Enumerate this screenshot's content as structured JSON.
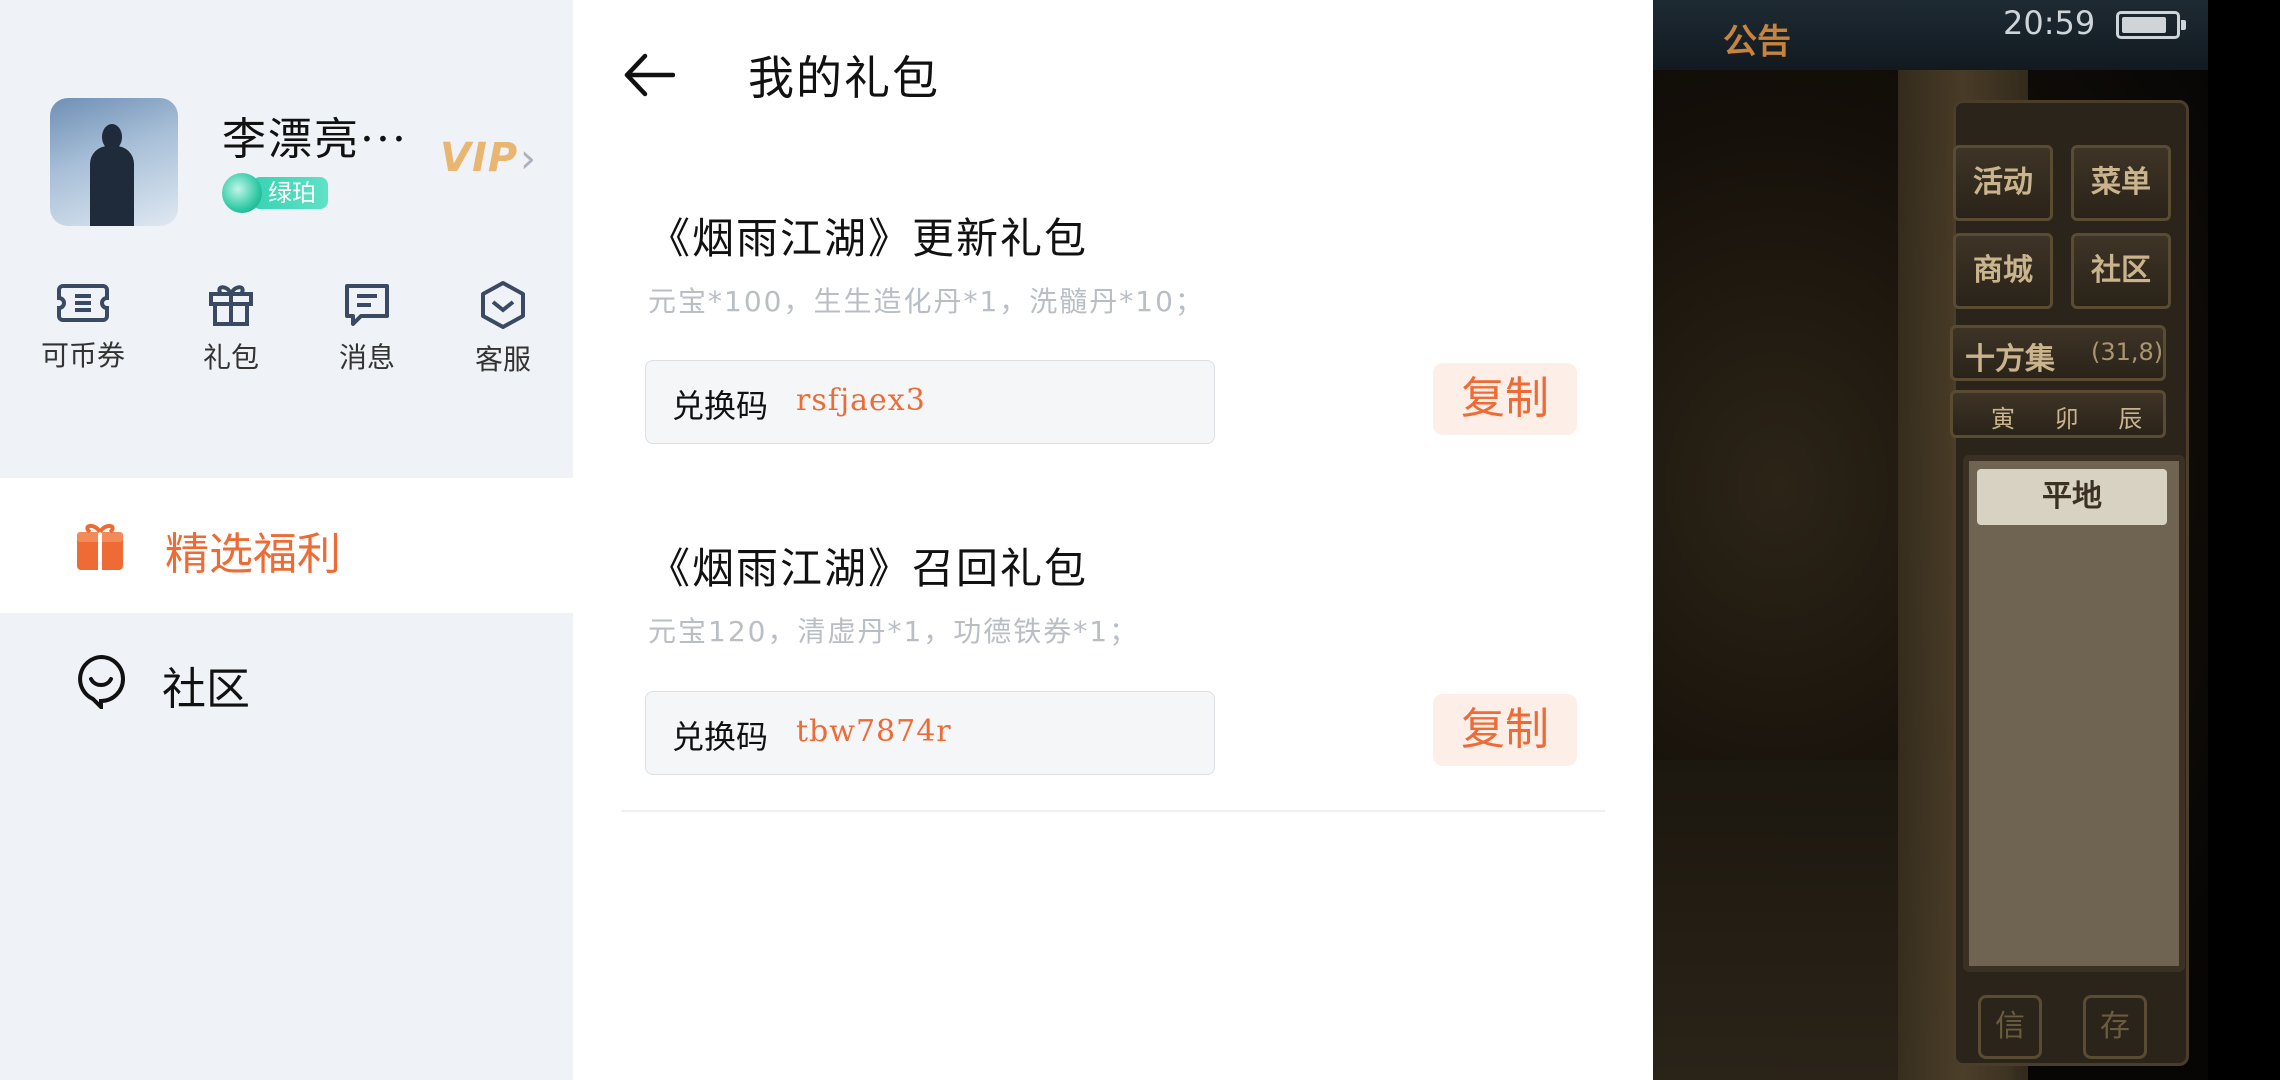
{
  "profile": {
    "username": "李漂亮···",
    "level": "绿珀",
    "vip": "VIP"
  },
  "quick_menu": [
    {
      "label": "可币券",
      "icon": "coupon-icon"
    },
    {
      "label": "礼包",
      "icon": "gift-icon"
    },
    {
      "label": "消息",
      "icon": "message-icon"
    },
    {
      "label": "客服",
      "icon": "customer-service-icon"
    }
  ],
  "nav": {
    "selected": {
      "label": "精选福利",
      "icon": "gift-box-icon"
    },
    "community": {
      "label": "社区",
      "icon": "community-icon"
    }
  },
  "main": {
    "title": "我的礼包",
    "gifts": [
      {
        "title": "《烟雨江湖》更新礼包",
        "desc": "元宝*100，生生造化丹*1，洗髓丹*10；",
        "code_label": "兑换码",
        "code": "rsfjaex3",
        "copy_label": "复制"
      },
      {
        "title": "《烟雨江湖》召回礼包",
        "desc": "元宝120，清虚丹*1，功德铁券*1；",
        "code_label": "兑换码",
        "code": "tbw7874r",
        "copy_label": "复制"
      }
    ]
  },
  "game": {
    "notice": "公告",
    "time": "20:59",
    "buttons": [
      "活动",
      "菜单",
      "商城",
      "社区"
    ],
    "location_name": "十方集",
    "coords": "(31,8)",
    "time_dial": "寅 卯 辰",
    "terrain": "平地",
    "bottom_buttons": [
      "信",
      "存"
    ]
  },
  "colors": {
    "accent": "#ee6b35",
    "vip": "#e9b672",
    "level": "#39d2b3"
  }
}
